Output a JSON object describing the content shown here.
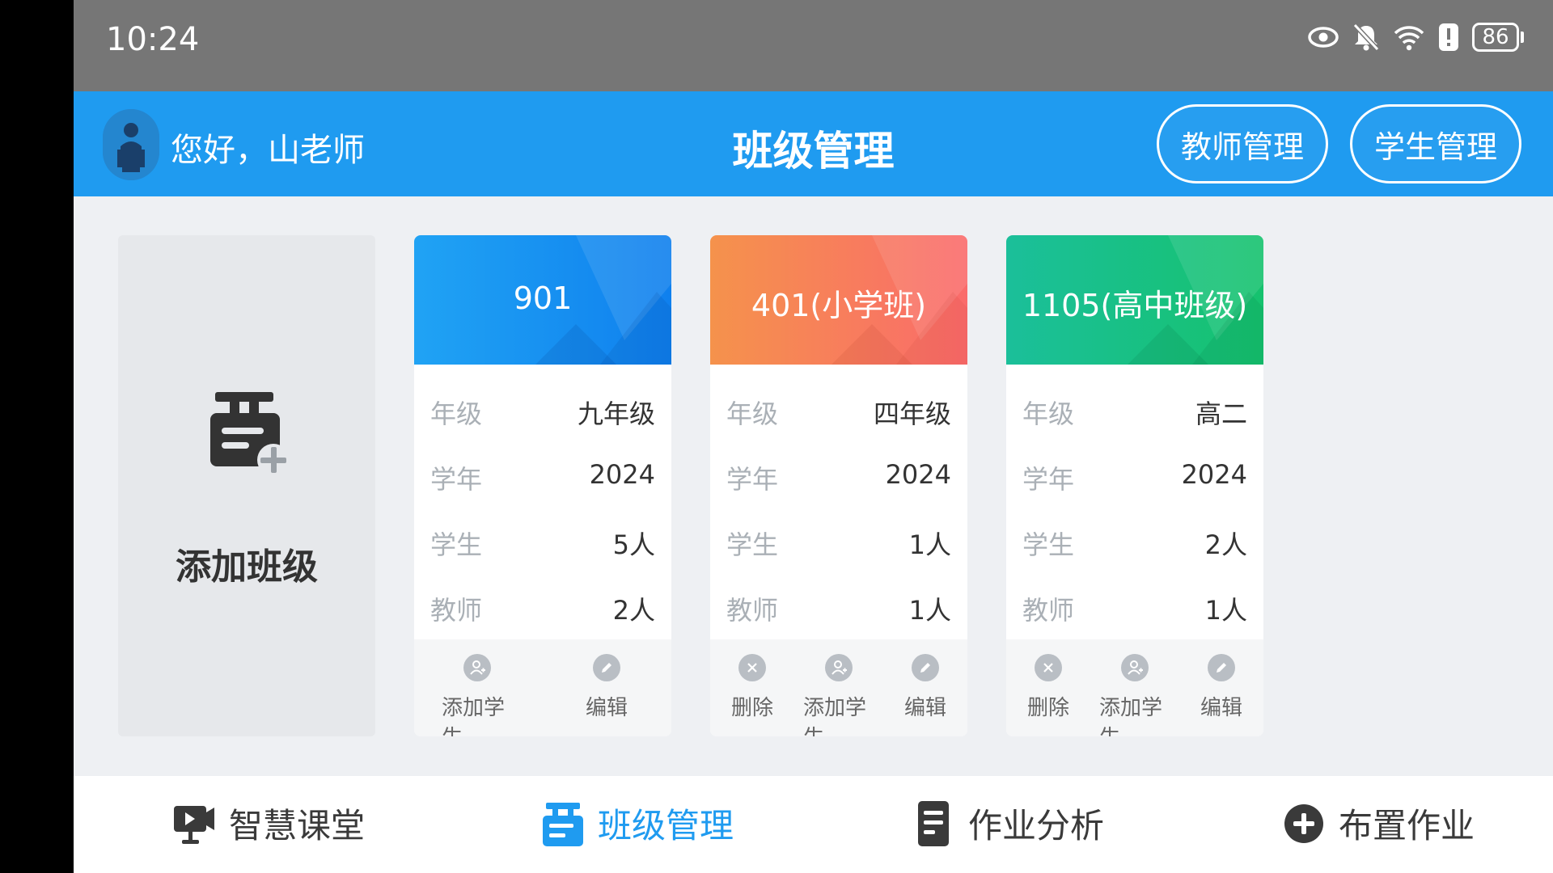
{
  "status_bar": {
    "time": "10:24",
    "battery": "86",
    "icons": [
      "eye-icon",
      "bell-off-icon",
      "wifi-icon",
      "alert-icon",
      "battery-icon"
    ]
  },
  "header": {
    "greeting": "您好，山老师",
    "title": "班级管理",
    "teacher_button": "教师管理",
    "student_button": "学生管理",
    "color": "#1f9bf0"
  },
  "add_class": {
    "label": "添加班级",
    "icon": "add-class-icon"
  },
  "classes": [
    {
      "name": "901",
      "theme": "blue",
      "rows": [
        {
          "label": "年级",
          "value": "九年级"
        },
        {
          "label": "学年",
          "value": "2024"
        },
        {
          "label": "学生",
          "value": "5人"
        },
        {
          "label": "教师",
          "value": "2人"
        }
      ],
      "actions": [
        {
          "label": "添加学生",
          "icon": "add-person-icon"
        },
        {
          "label": "编辑",
          "icon": "edit-icon"
        }
      ]
    },
    {
      "name": "401(小学班)",
      "theme": "orange",
      "rows": [
        {
          "label": "年级",
          "value": "四年级"
        },
        {
          "label": "学年",
          "value": "2024"
        },
        {
          "label": "学生",
          "value": "1人"
        },
        {
          "label": "教师",
          "value": "1人"
        }
      ],
      "actions": [
        {
          "label": "删除",
          "icon": "delete-icon"
        },
        {
          "label": "添加学生",
          "icon": "add-person-icon"
        },
        {
          "label": "编辑",
          "icon": "edit-icon"
        }
      ]
    },
    {
      "name": "1105(高中班级)",
      "theme": "green",
      "rows": [
        {
          "label": "年级",
          "value": "高二"
        },
        {
          "label": "学年",
          "value": "2024"
        },
        {
          "label": "学生",
          "value": "2人"
        },
        {
          "label": "教师",
          "value": "1人"
        }
      ],
      "actions": [
        {
          "label": "删除",
          "icon": "delete-icon"
        },
        {
          "label": "添加学生",
          "icon": "add-person-icon"
        },
        {
          "label": "编辑",
          "icon": "edit-icon"
        }
      ]
    }
  ],
  "bottom_nav": [
    {
      "label": "智慧课堂",
      "icon": "smart-classroom-icon",
      "active": false
    },
    {
      "label": "班级管理",
      "icon": "class-management-icon",
      "active": true
    },
    {
      "label": "作业分析",
      "icon": "homework-analysis-icon",
      "active": false
    },
    {
      "label": "布置作业",
      "icon": "assign-homework-icon",
      "active": false
    }
  ],
  "colors": {
    "accent": "#1f9bf0",
    "blue_card": "#1a8ff5",
    "orange_card": "#f98866",
    "green_card": "#1fc28f"
  }
}
